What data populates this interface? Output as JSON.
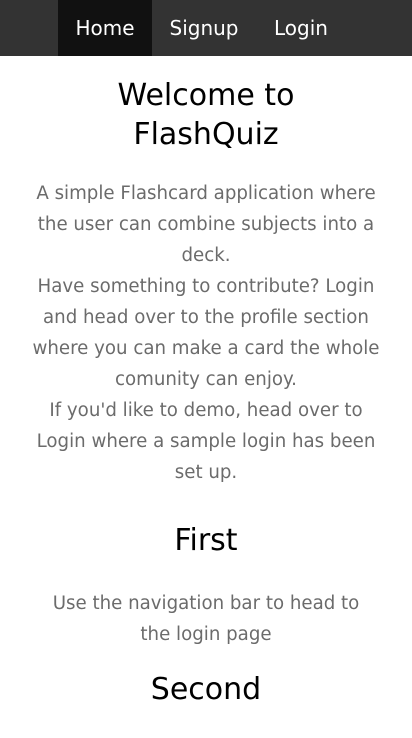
{
  "nav": {
    "items": [
      {
        "label": "Home",
        "active": true
      },
      {
        "label": "Signup",
        "active": false
      },
      {
        "label": "Login",
        "active": false
      }
    ]
  },
  "main": {
    "title": "Welcome to FlashQuiz",
    "intro": [
      "A simple Flashcard application where the user can combine subjects into a deck.",
      "Have something to contribute? Login and head over to the profile section where you can make a card the whole comunity can enjoy.",
      "If you'd like to demo, head over to Login where a sample login has been set up."
    ]
  },
  "sections": [
    {
      "title": "First",
      "text": "Use the navigation bar to head to the login page"
    },
    {
      "title": "Second"
    }
  ],
  "colors": {
    "navbar_bg": "#333333",
    "nav_active_bg": "#111111",
    "nav_text": "#ffffff",
    "heading": "#000000",
    "body_text": "#6b6b6b"
  }
}
